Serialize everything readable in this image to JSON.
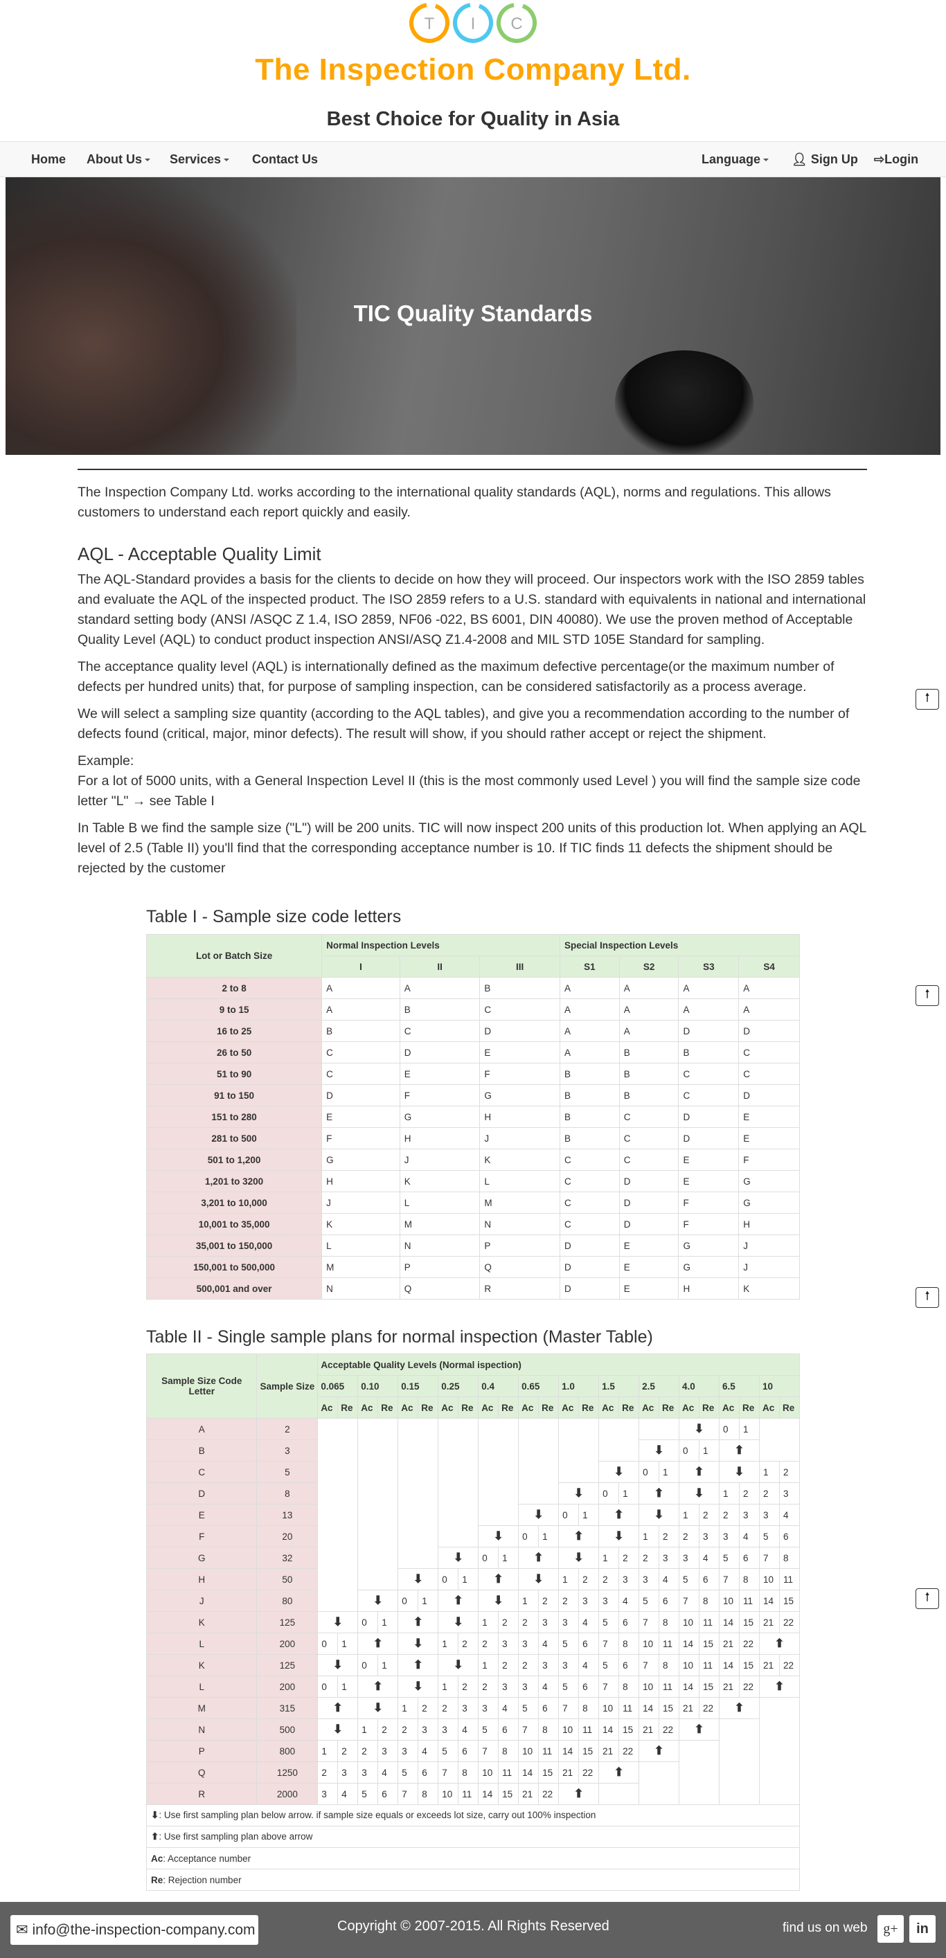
{
  "header": {
    "logo_letters": [
      "T",
      "I",
      "C"
    ],
    "logo_colors": [
      "#ffa500",
      "#4fc8f0",
      "#8ccc6e"
    ],
    "company_name": "The Inspection Company Ltd.",
    "tagline": "Best Choice for Quality in Asia"
  },
  "nav": {
    "home": "Home",
    "about": "About Us",
    "services": "Services",
    "contact": "Contact Us",
    "language": "Language",
    "signup": "Sign Up",
    "login": "Login"
  },
  "hero": {
    "title": "TIC Quality Standards"
  },
  "content": {
    "intro": "The Inspection Company Ltd. works according to the international quality standards (AQL), norms and regulations. This allows customers to understand each report quickly and easily.",
    "aql_heading": "AQL - Acceptable Quality Limit",
    "p1": "The AQL-Standard provides a basis for the clients to decide on how they will proceed. Our inspectors work with the ISO 2859 tables and evaluate the AQL of the inspected product. The ISO 2859 refers to a U.S. standard with equivalents in national and international standard setting body (ANSI /ASQC Z 1.4, ISO 2859, NF06 -022, BS 6001, DIN 40080). We use the proven method of Acceptable Quality Level (AQL) to conduct product inspection ANSI/ASQ Z1.4-2008 and MIL STD 105E Standard for sampling.",
    "p2": "The acceptance quality level (AQL) is internationally defined as the maximum defective percentage(or the maximum number of defects per hundred units) that, for purpose of sampling inspection, can be considered satisfactorily as a process average.",
    "p3": "We will select a sampling size quantity (according to the AQL tables), and give you a recommendation according to the number of defects found (critical, major, minor defects). The result will show, if you should rather accept or reject the shipment.",
    "example_label": "Example:",
    "example_text": "For a lot of 5000 units, with a General Inspection Level II (this is the most commonly used Level ) you will find the sample size code letter \"L\" → see Table I",
    "p4": "In Table B we find the sample size (\"L\") will be 200 units. TIC will now inspect 200 units of this production lot. When applying an AQL level of 2.5 (Table II) you'll find that the corresponding acceptance number is 10. If TIC finds 11 defects the shipment should be rejected by the customer"
  },
  "table1": {
    "title": "Table I - Sample size code letters",
    "lot_header": "Lot or Batch Size",
    "normal_header": "Normal Inspection Levels",
    "special_header": "Special Inspection Levels",
    "levels": [
      "I",
      "II",
      "III",
      "S1",
      "S2",
      "S3",
      "S4"
    ],
    "rows": [
      {
        "lot": "2 to 8",
        "codes": [
          "A",
          "A",
          "B",
          "A",
          "A",
          "A",
          "A"
        ]
      },
      {
        "lot": "9 to 15",
        "codes": [
          "A",
          "B",
          "C",
          "A",
          "A",
          "A",
          "A"
        ]
      },
      {
        "lot": "16 to 25",
        "codes": [
          "B",
          "C",
          "D",
          "A",
          "A",
          "D",
          "D"
        ]
      },
      {
        "lot": "26 to 50",
        "codes": [
          "C",
          "D",
          "E",
          "A",
          "B",
          "B",
          "C"
        ]
      },
      {
        "lot": "51 to 90",
        "codes": [
          "C",
          "E",
          "F",
          "B",
          "B",
          "C",
          "C"
        ]
      },
      {
        "lot": "91 to 150",
        "codes": [
          "D",
          "F",
          "G",
          "B",
          "B",
          "C",
          "D"
        ]
      },
      {
        "lot": "151 to 280",
        "codes": [
          "E",
          "G",
          "H",
          "B",
          "C",
          "D",
          "E"
        ]
      },
      {
        "lot": "281 to 500",
        "codes": [
          "F",
          "H",
          "J",
          "B",
          "C",
          "D",
          "E"
        ]
      },
      {
        "lot": "501 to 1,200",
        "codes": [
          "G",
          "J",
          "K",
          "C",
          "C",
          "E",
          "F"
        ]
      },
      {
        "lot": "1,201 to 3200",
        "codes": [
          "H",
          "K",
          "L",
          "C",
          "D",
          "E",
          "G"
        ]
      },
      {
        "lot": "3,201 to 10,000",
        "codes": [
          "J",
          "L",
          "M",
          "C",
          "D",
          "F",
          "G"
        ]
      },
      {
        "lot": "10,001 to 35,000",
        "codes": [
          "K",
          "M",
          "N",
          "C",
          "D",
          "F",
          "H"
        ]
      },
      {
        "lot": "35,001 to 150,000",
        "codes": [
          "L",
          "N",
          "P",
          "D",
          "E",
          "G",
          "J"
        ]
      },
      {
        "lot": "150,001 to 500,000",
        "codes": [
          "M",
          "P",
          "Q",
          "D",
          "E",
          "G",
          "J"
        ]
      },
      {
        "lot": "500,001 and over",
        "codes": [
          "N",
          "Q",
          "R",
          "D",
          "E",
          "H",
          "K"
        ]
      }
    ]
  },
  "table2": {
    "title": "Table II - Single sample plans for normal inspection (Master Table)",
    "code_header": "Sample Size Code Letter",
    "size_header": "Sample Size",
    "aql_header": "Acceptable Quality Levels (Normal ispection)",
    "aql_levels": [
      "0.065",
      "0.10",
      "0.15",
      "0.25",
      "0.4",
      "0.65",
      "1.0",
      "1.5",
      "2.5",
      "4.0",
      "6.5",
      "10"
    ],
    "ac": "Ac",
    "re": "Re",
    "rows": [
      {
        "code": "A",
        "size": "2",
        "plan": "- - - - - - - - - v 0/1 -"
      },
      {
        "code": "B",
        "size": "3",
        "plan": "- - - - - - - - v 0/1 ^ -"
      },
      {
        "code": "C",
        "size": "5",
        "plan": "- - - - - - - v 0/1 ^ v 1/2"
      },
      {
        "code": "D",
        "size": "8",
        "plan": "- - - - - - v 0/1 ^ v 1/2 2/3"
      },
      {
        "code": "E",
        "size": "13",
        "plan": "- - - - - v 0/1 ^ v 1/2 2/3 3/4"
      },
      {
        "code": "F",
        "size": "20",
        "plan": "- - - - v 0/1 ^ v 1/2 2/3 3/4 5/6"
      },
      {
        "code": "G",
        "size": "32",
        "plan": "- - - v 0/1 ^ v 1/2 2/3 3/4 5/6 7/8"
      },
      {
        "code": "H",
        "size": "50",
        "plan": "- - v 0/1 ^ v 1/2 2/3 3/4 5/6 7/8 10/11"
      },
      {
        "code": "J",
        "size": "80",
        "plan": "- v 0/1 ^ v 1/2 2/3 3/4 5/6 7/8 10/11 14/15"
      },
      {
        "code": "K",
        "size": "125",
        "plan": "v 0/1 ^ v 1/2 2/3 3/4 5/6 7/8 10/11 14/15 21/22"
      },
      {
        "code": "L",
        "size": "200",
        "plan": "0/1 ^ v 1/2 2/3 3/4 5/6 7/8 10/11 14/15 21/22 ^"
      },
      {
        "code": "K",
        "size": "125",
        "plan": "v 0/1 ^ v 1/2 2/3 3/4 5/6 7/8 10/11 14/15 21/22"
      },
      {
        "code": "L",
        "size": "200",
        "plan": "0/1 ^ v 1/2 2/3 3/4 5/6 7/8 10/11 14/15 21/22 ^"
      },
      {
        "code": "M",
        "size": "315",
        "plan": "^ v 1/2 2/3 3/4 5/6 7/8 10/11 14/15 21/22 ^ -"
      },
      {
        "code": "N",
        "size": "500",
        "plan": "v 1/2 2/3 3/4 5/6 7/8 10/11 14/15 21/22 ^ - -"
      },
      {
        "code": "P",
        "size": "800",
        "plan": "1/2 2/3 3/4 5/6 7/8 10/11 14/15 21/22 ^ - - -"
      },
      {
        "code": "Q",
        "size": "1250",
        "plan": "2/3 3/4 5/6 7/8 10/11 14/15 21/22 ^ - - - -"
      },
      {
        "code": "R",
        "size": "2000",
        "plan": "3/4 5/6 7/8 10/11 14/15 21/22 ^ - - - - -"
      }
    ],
    "legend": [
      {
        "key": "⬇",
        "text": ": Use first sampling plan below arrow. if sample size equals or exceeds lot size, carry out 100% inspection"
      },
      {
        "key": "⬆",
        "text": ": Use first sampling plan above arrow"
      },
      {
        "key": "Ac",
        "text": ": Acceptance number"
      },
      {
        "key": "Re",
        "text": ": Rejection number"
      }
    ]
  },
  "footer": {
    "email": "info@the-inspection-company.com",
    "copyright": "Copyright © 2007-2015. All Rights Reserved",
    "find_us": "find us on web",
    "gplus": "g+",
    "linkedin": "in"
  }
}
